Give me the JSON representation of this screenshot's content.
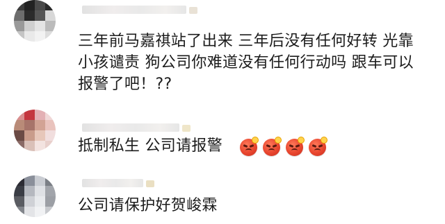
{
  "comments": [
    {
      "text": "三年前马嘉祺站了出来 三年后没有任何好转 光靠\n小孩谴责 狗公司你难道没有任何行动吗 跟车可以\n报警了吧！??"
    },
    {
      "text": "抵制私生 公司请报警",
      "emojis": [
        "angry-face-icon",
        "angry-face-icon",
        "angry-face-icon",
        "angry-face-icon"
      ]
    },
    {
      "text": "公司请保护好贺峻霖"
    }
  ],
  "colors": {
    "background": "#ffffff",
    "text": "#1c1c1c",
    "blur": "#e8e8e8",
    "emoji": "#e8452e"
  }
}
